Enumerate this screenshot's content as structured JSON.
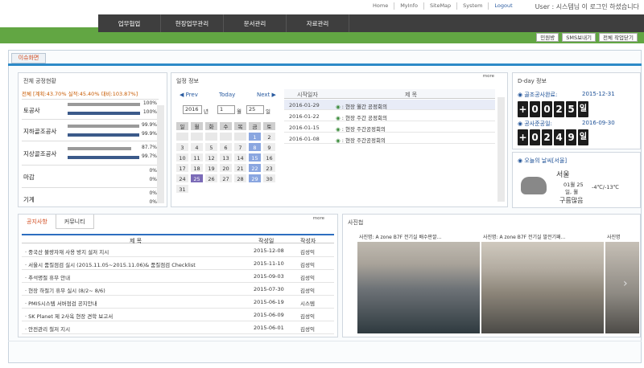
{
  "topbar": {
    "links": [
      "Home",
      "MyInfo",
      "SiteMap",
      "System",
      "Logout"
    ],
    "user": "User : 시스템님 이 로그인 하셨습니다"
  },
  "nav": {
    "items": [
      "업무협업",
      "현장업무관리",
      "문서관리",
      "자료관리"
    ]
  },
  "actions": {
    "buttons": [
      "민원방",
      "SMS보내기",
      "전체 작업닫기"
    ]
  },
  "issue_tab": "이슈화면",
  "progress": {
    "title": "전체 공정현황",
    "summary": "전체 [계획:43.70% 실적:45.40% 대비:103.87%]",
    "rows": [
      {
        "label": "토공사",
        "v1": "100%",
        "v2": "100%",
        "f1": 1.0,
        "f2": 1.0
      },
      {
        "label": "지하골조공사",
        "v1": "99.9%",
        "v2": "99.9%",
        "f1": 0.999,
        "f2": 0.999
      },
      {
        "label": "지상골조공사",
        "v1": "87.7%",
        "v2": "99.7%",
        "f1": 0.877,
        "f2": 0.997
      },
      {
        "label": "마감",
        "v1": "0%",
        "v2": "0%",
        "f1": 0,
        "f2": 0
      },
      {
        "label": "기계",
        "v1": "0%",
        "v2": "0%",
        "f1": 0,
        "f2": 0
      }
    ]
  },
  "schedule": {
    "title": "일정 정보",
    "more": "more",
    "prev": "Prev",
    "today": "Today",
    "next": "Next",
    "year": "2016",
    "year_unit": "년",
    "month": "1",
    "month_unit": "월",
    "day": "25",
    "day_unit": "일",
    "weekdays": [
      "일",
      "월",
      "화",
      "수",
      "목",
      "금",
      "토"
    ],
    "days": [
      "",
      "",
      "",
      "",
      "",
      "1",
      "2",
      "3",
      "4",
      "5",
      "6",
      "7",
      "8",
      "9",
      "10",
      "11",
      "12",
      "13",
      "14",
      "15",
      "16",
      "17",
      "18",
      "19",
      "20",
      "21",
      "22",
      "23",
      "24",
      "25",
      "26",
      "27",
      "28",
      "29",
      "30",
      "31"
    ],
    "head": [
      "시작일자",
      "제 목"
    ],
    "events": [
      {
        "date": "2016-01-29",
        "title": "현장 월간 공정회의"
      },
      {
        "date": "2016-01-22",
        "title": "현장 주간 공정회의"
      },
      {
        "date": "2016-01-15",
        "title": "현장 주간공정회의"
      },
      {
        "date": "2016-01-08",
        "title": "현장 주간공정회의"
      }
    ]
  },
  "dday": {
    "title": "D-day 정보",
    "items": [
      {
        "label": "골조공사완료:",
        "date": "2015-12-31",
        "digits": [
          "+",
          "0",
          "0",
          "2",
          "5"
        ],
        "unit": "일"
      },
      {
        "label": "공사준공일:",
        "date": "2016-09-30",
        "digits": [
          "+",
          "0",
          "2",
          "4",
          "9"
        ],
        "unit": "일"
      }
    ]
  },
  "weather": {
    "title": "오늘의 날씨[서울]",
    "city": "서울",
    "date": "01월 25",
    "day": "일, 월",
    "temp": "-4℃/-13℃",
    "cond": "구름많음"
  },
  "notice": {
    "tabs": [
      "공지사항",
      "커뮤니티"
    ],
    "more": "more",
    "head": [
      "제 목",
      "작성일",
      "작성자"
    ],
    "rows": [
      {
        "t": "중국산 불량자재 사용 방지 설저 지시",
        "d": "2015-12-08",
        "w": "김성익"
      },
      {
        "t": "서울시 품질점검 실시 (2015.11.05~2015.11.06)& 품질점검 Checklist",
        "d": "2015-11-10",
        "w": "김성익"
      },
      {
        "t": "추석명절 휴무 안내",
        "d": "2015-09-03",
        "w": "김성익"
      },
      {
        "t": "현장 하절기 휴무 실시 (8/2~ 8/6)",
        "d": "2015-07-30",
        "w": "김성익"
      },
      {
        "t": "PMIS시스템 서버점검 공지안내",
        "d": "2015-06-19",
        "w": "시스템"
      },
      {
        "t": "SK Planet 제 2사옥 현장 견학 보고서",
        "d": "2015-06-09",
        "w": "김성익"
      },
      {
        "t": "안전관리 철저 지시",
        "d": "2015-06-01",
        "w": "김성익"
      }
    ]
  },
  "photos": {
    "title": "사진첩",
    "captions": [
      "사진명: A zone B7F 전기실 배수판깔...",
      "사진명: A zone B7F 전기실 발전기패...",
      "사진명"
    ]
  }
}
